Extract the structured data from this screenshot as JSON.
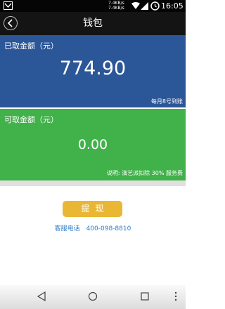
{
  "status_bar": {
    "net_speed_up": "7.4KB/s",
    "net_speed_down": "7.4KB/s",
    "time": "16:05"
  },
  "header": {
    "title": "钱包"
  },
  "withdrawn": {
    "label": "已取金额（元）",
    "amount": "774.90",
    "note": "每月8号到账"
  },
  "available": {
    "label": "可取金额（元）",
    "amount": "0.00",
    "note": "说明: 演艺派扣除 30% 服务费"
  },
  "actions": {
    "withdraw_label": "提现"
  },
  "support": {
    "phone_label": "客服电话",
    "phone_number": "400-098-8810"
  },
  "colors": {
    "withdrawn_bg": "#2b5698",
    "available_bg": "#41b14a",
    "button_bg": "#e9b733",
    "link": "#2e7ac4"
  },
  "icons": [
    "notification-icon",
    "wifi-icon",
    "signal-icon",
    "alarm-icon",
    "back-icon",
    "nav-back-icon",
    "nav-home-icon",
    "nav-recents-icon"
  ]
}
